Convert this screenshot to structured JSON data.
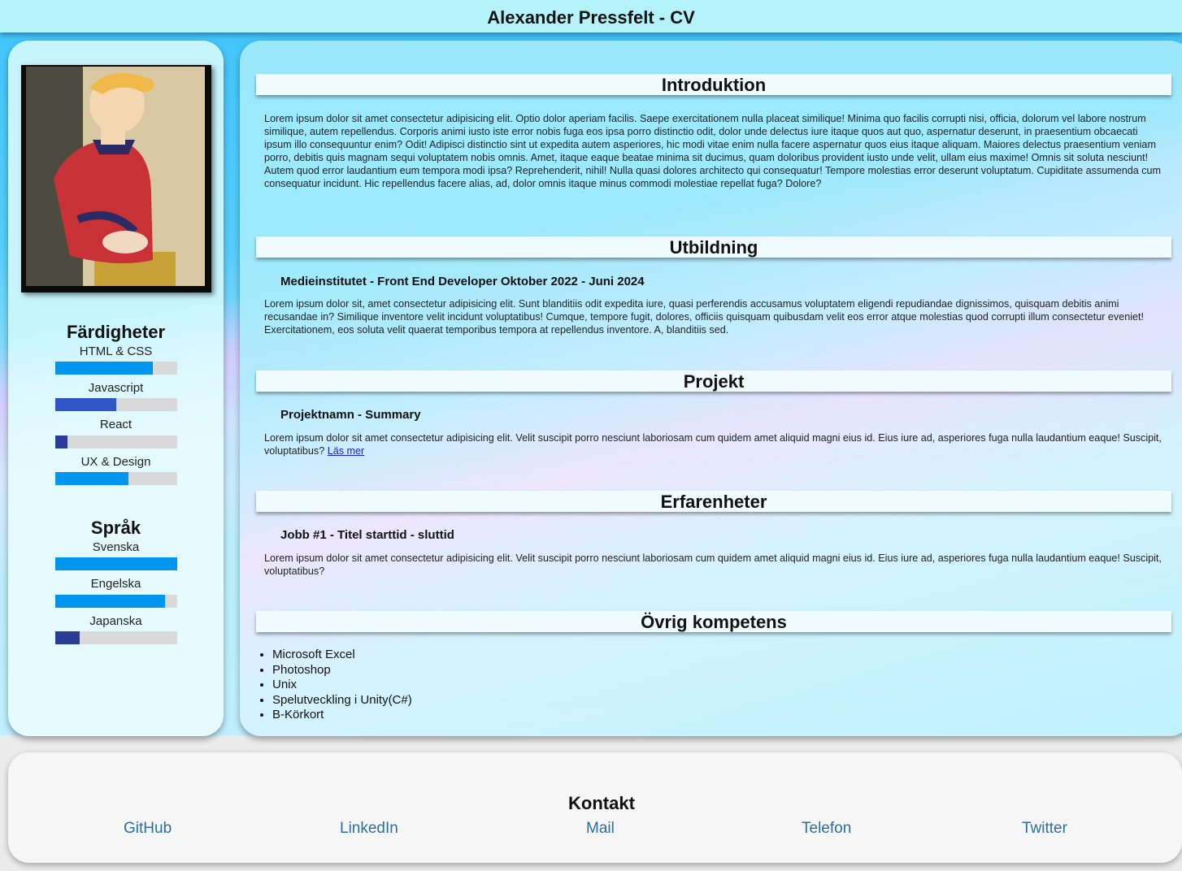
{
  "header": {
    "title": "Alexander Pressfelt - CV"
  },
  "sidebar": {
    "skills_title": "Färdigheter",
    "skills": [
      {
        "label": "HTML & CSS",
        "level": 0.8,
        "color": "#0096f0"
      },
      {
        "label": "Javascript",
        "level": 0.5,
        "color": "#2f55c6"
      },
      {
        "label": "React",
        "level": 0.1,
        "color": "#2a3d94"
      },
      {
        "label": "UX & Design",
        "level": 0.6,
        "color": "#0096f0"
      }
    ],
    "languages_title": "Språk",
    "languages": [
      {
        "label": "Svenska",
        "level": 1.0,
        "color": "#0096f0"
      },
      {
        "label": "Engelska",
        "level": 0.9,
        "color": "#0096f0"
      },
      {
        "label": "Japanska",
        "level": 0.2,
        "color": "#2a3d94"
      }
    ]
  },
  "main": {
    "intro": {
      "title": "Introduktion",
      "text": "Lorem ipsum dolor sit amet consectetur adipisicing elit. Optio dolor aperiam facilis. Saepe exercitationem nulla placeat similique! Minima quo facilis corrupti nisi, officia, dolorum vel labore nostrum similique, autem repellendus. Corporis animi iusto iste error nobis fuga eos ipsa porro distinctio odit, dolor unde delectus iure itaque quos aut quo, aspernatur deserunt, in praesentium obcaecati ipsum illo consequuntur enim? Odit! Adipisci distinctio sint ut expedita autem asperiores, hic modi vitae enim nulla facere aspernatur quos eius itaque aliquam. Maiores delectus praesentium veniam porro, debitis quis magnam sequi voluptatem nobis omnis. Amet, itaque eaque beatae minima sit ducimus, quam doloribus provident iusto unde velit, ullam eius maxime! Omnis sit soluta nesciunt! Autem quod error laudantium eum tempora modi ipsa? Reprehenderit, nihil! Nulla quasi dolores architecto qui consequatur! Tempore molestias error deserunt voluptatum. Cupiditate assumenda cum consequatur incidunt. Hic repellendus facere alias, ad, dolor omnis itaque minus commodi molestiae repellat fuga? Dolore?"
    },
    "education": {
      "title": "Utbildning",
      "entry_title": "Medieinstitutet - Front End Developer Oktober 2022 - Juni 2024",
      "text": "Lorem ipsum dolor sit, amet consectetur adipisicing elit. Sunt blanditiis odit expedita iure, quasi perferendis accusamus voluptatem eligendi repudiandae dignissimos, quisquam debitis animi recusandae in? Similique inventore velit incidunt voluptatibus! Cumque, tempore fugit, dolores, officiis quisquam quibusdam velit eos error atque molestias quod corrupti illum consectetur eveniet! Exercitationem, eos soluta velit quaerat temporibus tempora at repellendus inventore. A, blanditiis sed."
    },
    "projects": {
      "title": "Projekt",
      "entry_title": "Projektnamn - Summary",
      "text": "Lorem ipsum dolor sit amet consectetur adipisicing elit. Velit suscipit porro nesciunt laboriosam cum quidem amet aliquid magni eius id. Eius iure ad, asperiores fuga nulla laudantium eaque! Suscipit, voluptatibus?",
      "link_label": "Läs mer"
    },
    "experience": {
      "title": "Erfarenheter",
      "entry_title": "Jobb #1 - Titel starttid - sluttid",
      "text": "Lorem ipsum dolor sit amet consectetur adipisicing elit. Velit suscipit porro nesciunt laboriosam cum quidem amet aliquid magni eius id. Eius iure ad, asperiores fuga nulla laudantium eaque! Suscipit, voluptatibus?"
    },
    "other": {
      "title": "Övrig kompetens",
      "items": [
        "Microsoft Excel",
        "Photoshop",
        "Unix",
        "Spelutveckling i Unity(C#)",
        "B-Körkort"
      ]
    }
  },
  "footer": {
    "title": "Kontakt",
    "links": [
      "GitHub",
      "LinkedIn",
      "Mail",
      "Telefon",
      "Twitter"
    ]
  }
}
